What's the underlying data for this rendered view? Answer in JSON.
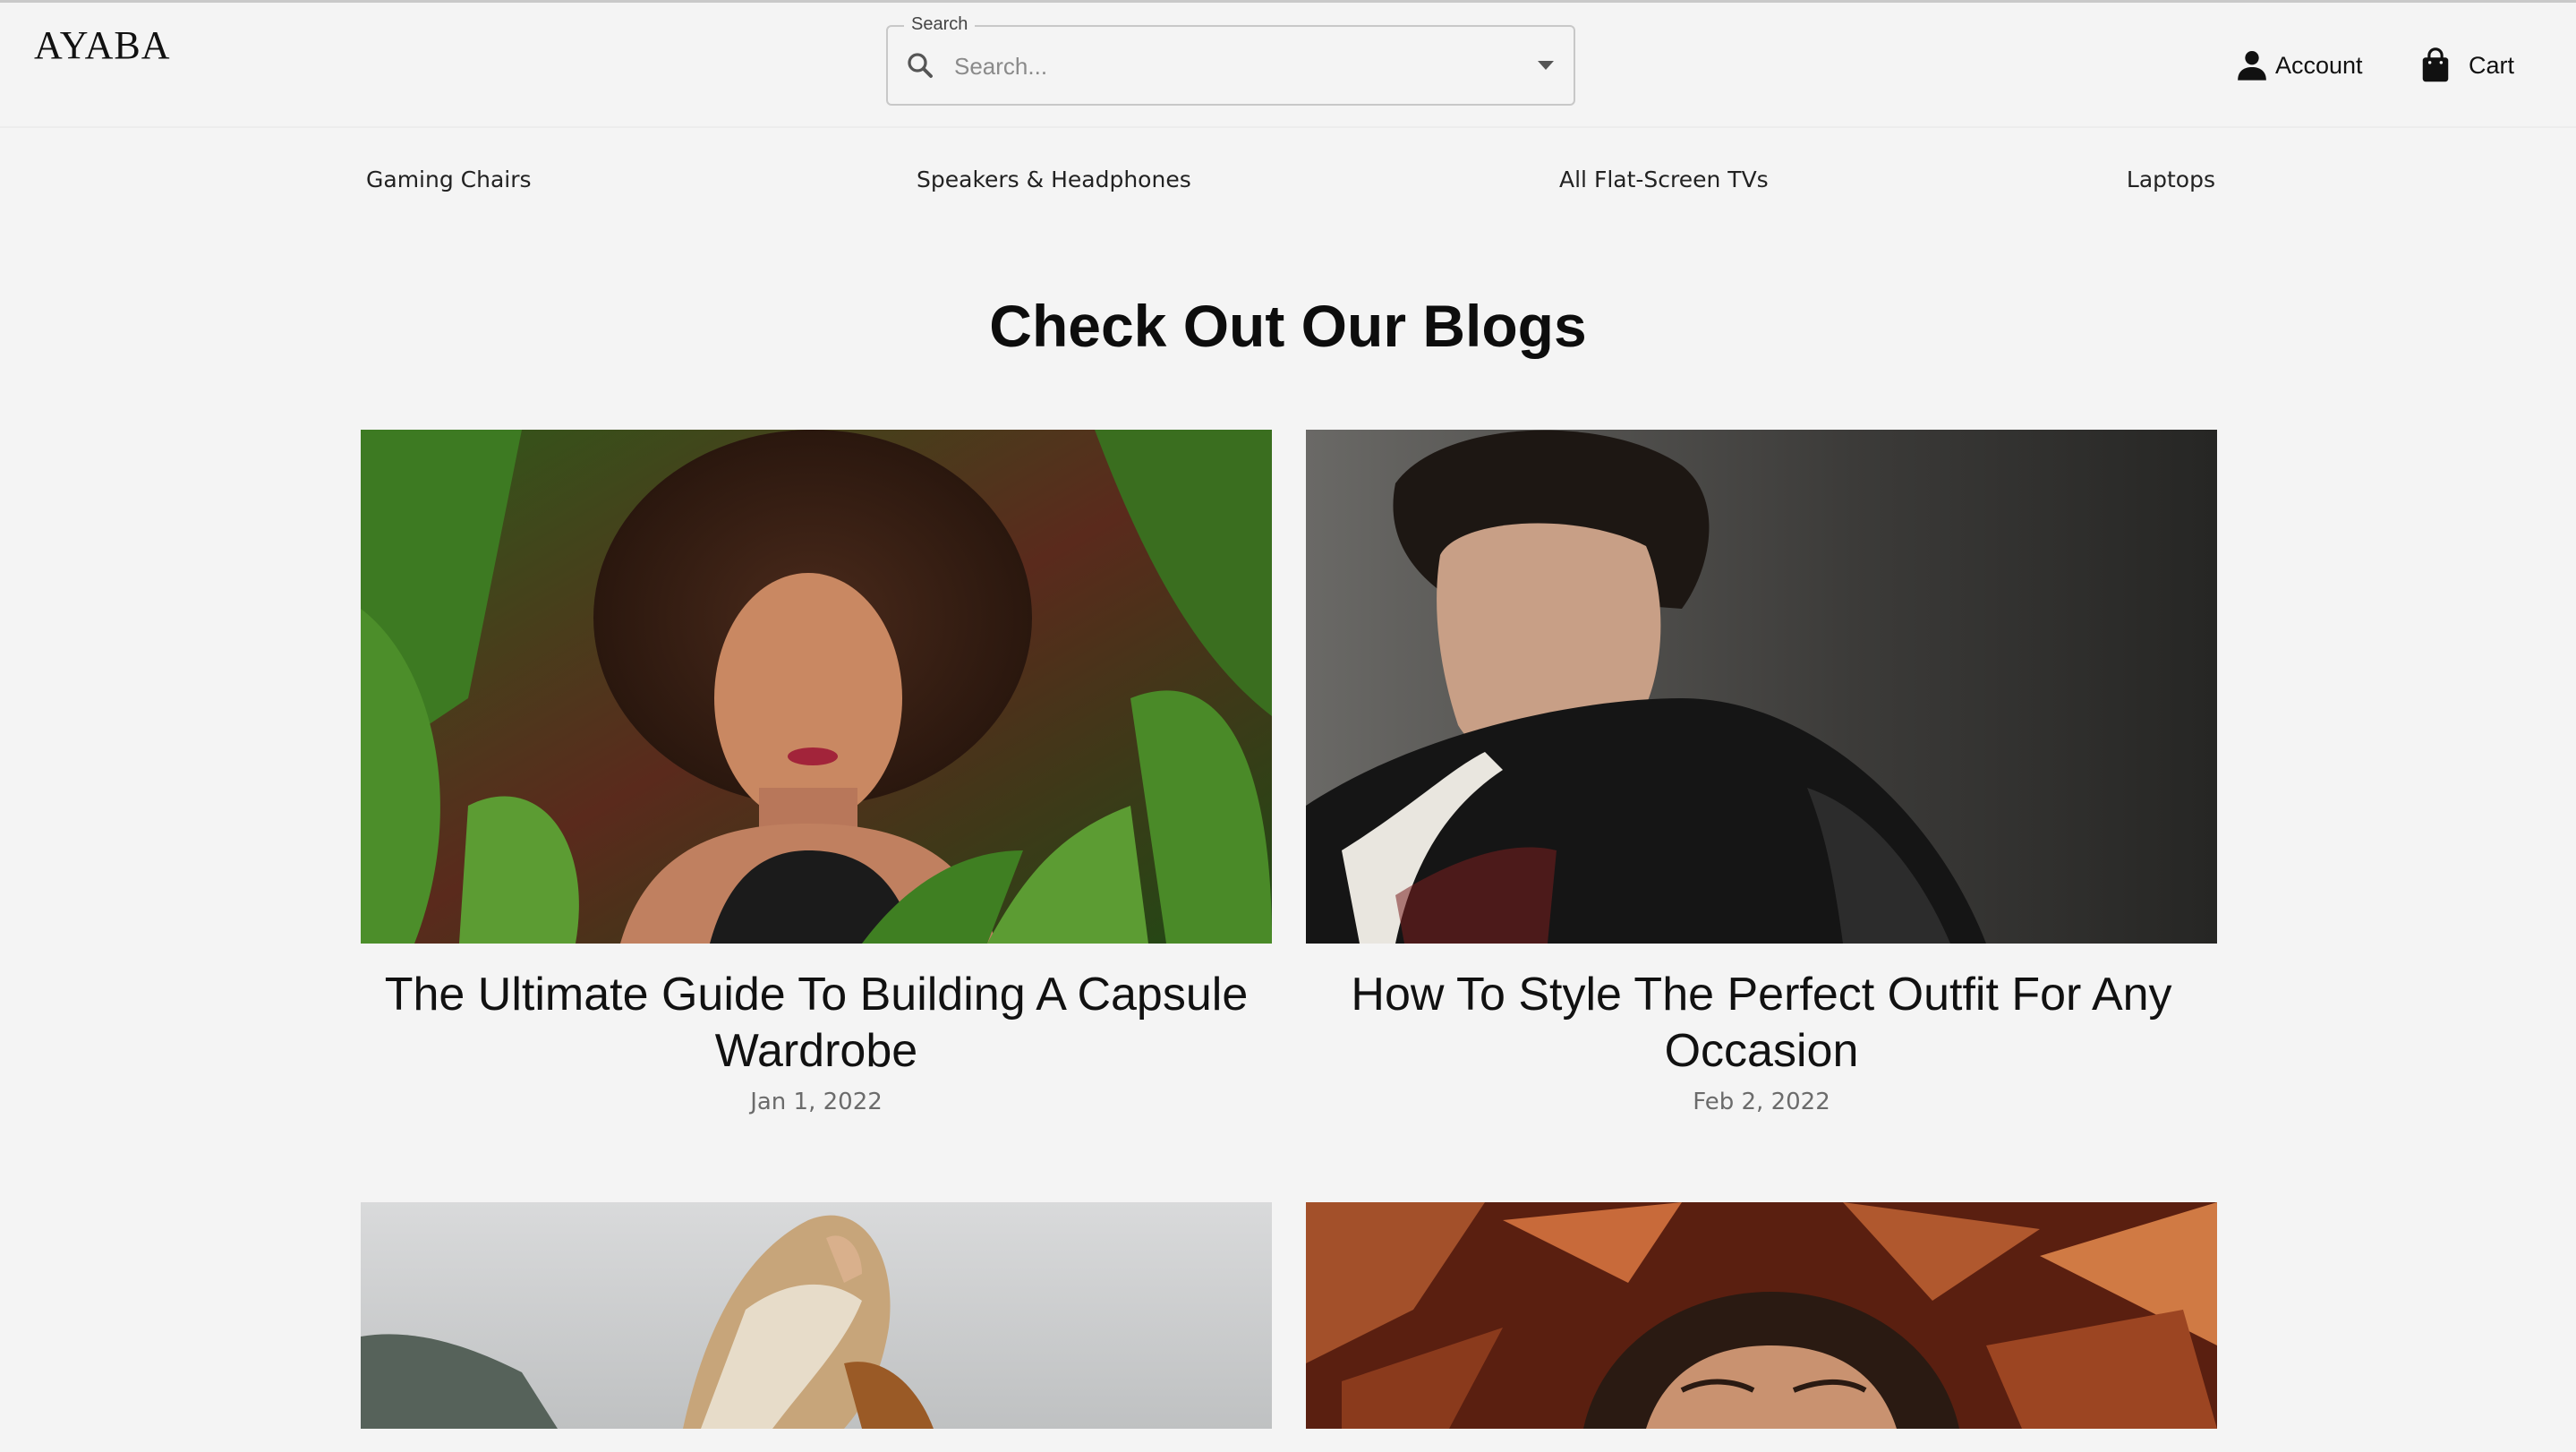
{
  "header": {
    "logo": "AYABA",
    "search": {
      "legend": "Search",
      "placeholder": "Search..."
    },
    "account_label": "Account",
    "cart_label": "Cart"
  },
  "nav": {
    "items": [
      {
        "label": "Gaming Chairs"
      },
      {
        "label": "Speakers & Headphones"
      },
      {
        "label": "All Flat-Screen TVs"
      },
      {
        "label": "Laptops"
      }
    ]
  },
  "blogs": {
    "heading": "Check Out Our Blogs",
    "posts": [
      {
        "title": "The Ultimate Guide To Building A Capsule Wardrobe",
        "date": "Jan 1, 2022"
      },
      {
        "title": "How To Style The Perfect Outfit For Any Occasion",
        "date": "Feb 2, 2022"
      },
      {
        "title": "",
        "date": ""
      },
      {
        "title": "",
        "date": ""
      }
    ]
  },
  "colors": {
    "background": "#f4f4f4",
    "text": "#111111",
    "muted": "#6b6b6b"
  }
}
